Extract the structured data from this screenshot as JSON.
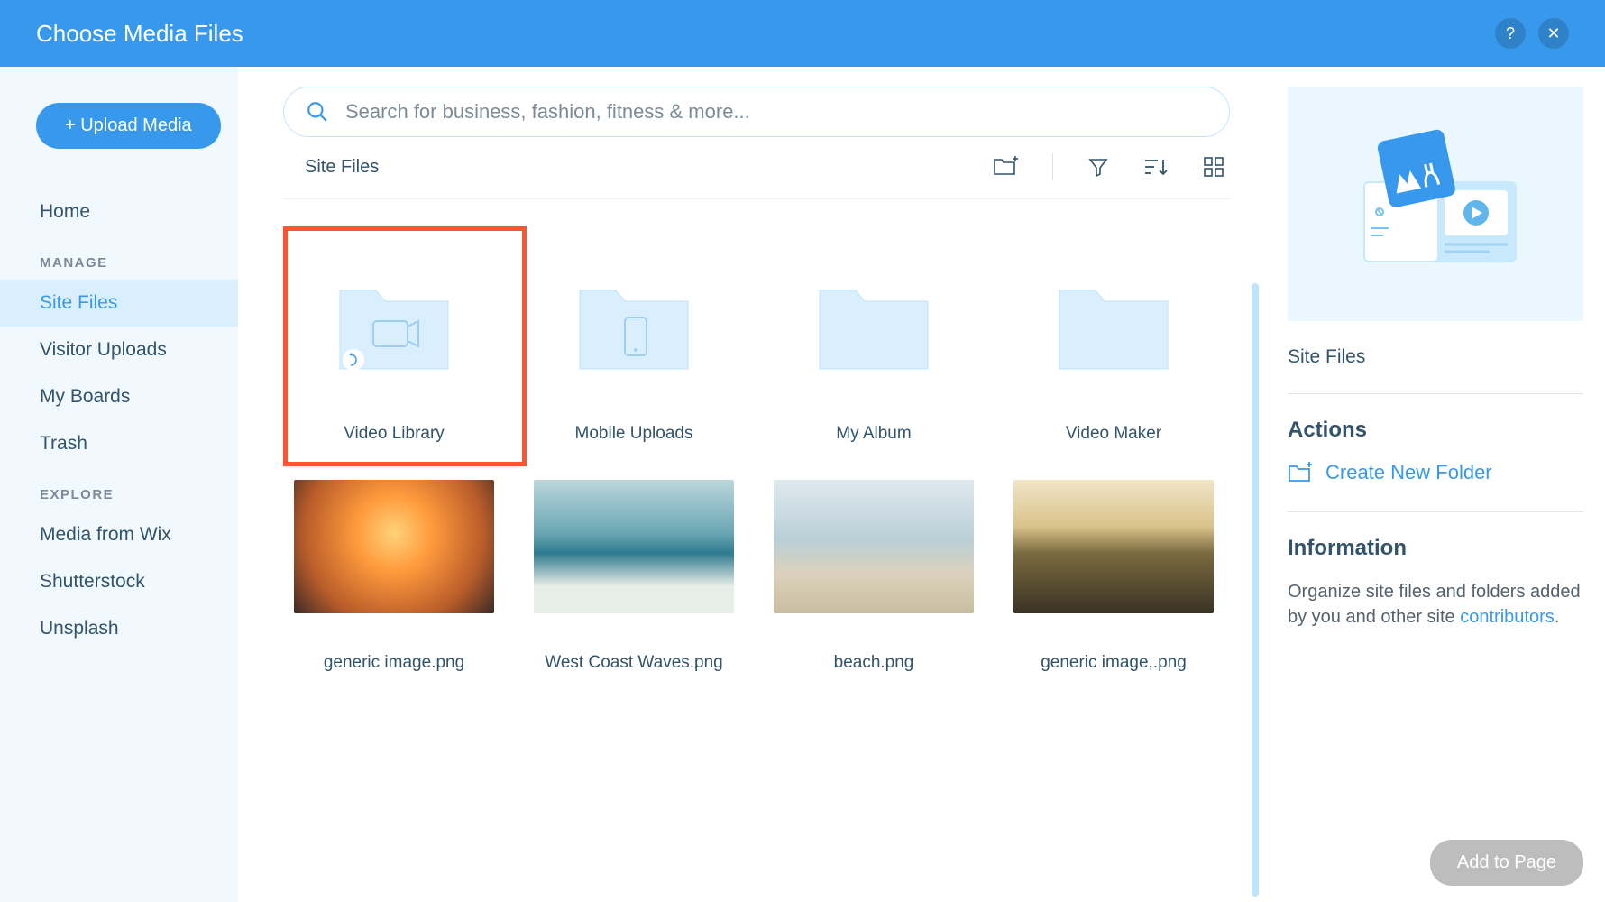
{
  "header": {
    "title": "Choose Media Files",
    "help_tooltip": "?",
    "close_tooltip": "✕"
  },
  "sidebar": {
    "upload_label": "+ Upload Media",
    "home_label": "Home",
    "manage_section": "MANAGE",
    "manage_items": [
      "Site Files",
      "Visitor Uploads",
      "My Boards",
      "Trash"
    ],
    "explore_section": "EXPLORE",
    "explore_items": [
      "Media from Wix",
      "Shutterstock",
      "Unsplash"
    ],
    "active_item": "Site Files"
  },
  "search": {
    "placeholder": "Search for business, fashion, fitness & more..."
  },
  "toolbar": {
    "location": "Site Files"
  },
  "folders": [
    {
      "label": "Video Library",
      "icon": "video",
      "highlighted": true
    },
    {
      "label": "Mobile Uploads",
      "icon": "mobile"
    },
    {
      "label": "My Album",
      "icon": "plain"
    },
    {
      "label": "Video Maker",
      "icon": "plain"
    }
  ],
  "images": [
    {
      "label": "generic image.png",
      "grad": "sunset-meditate"
    },
    {
      "label": "West Coast Waves.png",
      "grad": "waves"
    },
    {
      "label": "beach.png",
      "grad": "beach"
    },
    {
      "label": "generic image,.png",
      "grad": "festival"
    }
  ],
  "info": {
    "title": "Site Files",
    "actions_head": "Actions",
    "create_folder": "Create New Folder",
    "information_head": "Information",
    "info_text_prefix": "Organize site files and folders added by you and other site ",
    "info_link": "contributors",
    "info_text_suffix": "."
  },
  "footer": {
    "add_to_page": "Add to Page"
  }
}
